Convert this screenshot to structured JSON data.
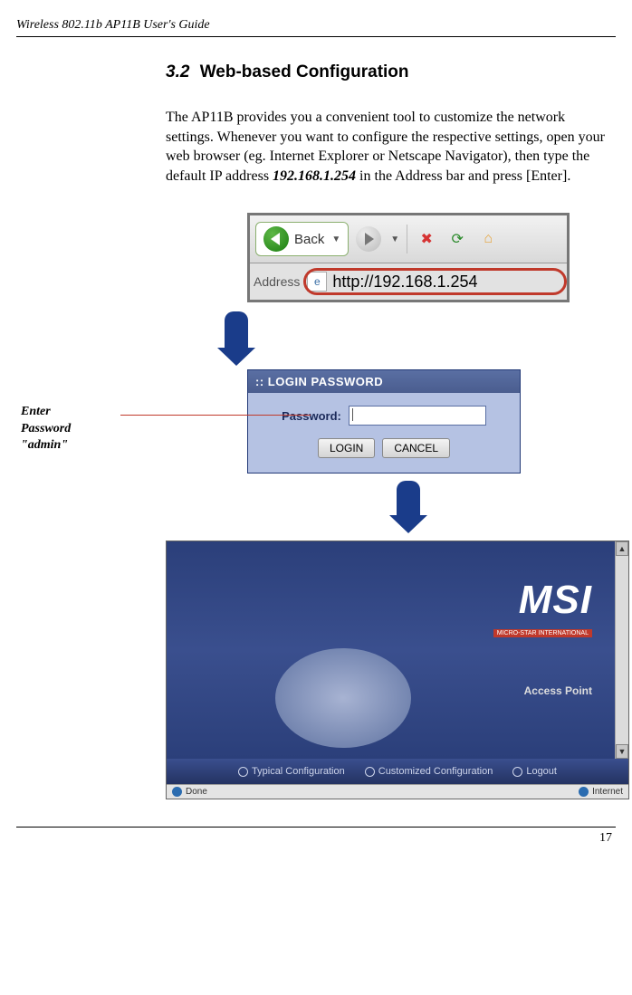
{
  "header": "Wireless 802.11b AP11B User's Guide",
  "section": {
    "number": "3.2",
    "title": "Web-based Configuration"
  },
  "paragraph": {
    "p1": "The AP11B provides you a convenient tool to customize the network settings.  Whenever you want to configure the respective settings, open your web browser (eg. Internet Explorer or Netscape Navigator), then type the default IP address ",
    "ip": "192.168.1.254",
    "p2": " in the Address bar and press [Enter]."
  },
  "browser_toolbar": {
    "back_label": "Back",
    "address_label": "Address",
    "url": "http://192.168.1.254"
  },
  "annotation": {
    "line1": "Enter",
    "line2": "Password",
    "line3": "\"admin\""
  },
  "login_dialog": {
    "title": "LOGIN PASSWORD",
    "password_label": "Password:",
    "login_btn": "LOGIN",
    "cancel_btn": "CANCEL"
  },
  "splash": {
    "logo_big": "MSI",
    "logo_sub": "MICRO-STAR INTERNATIONAL",
    "product": "Access Point",
    "nav": [
      "Typical Configuration",
      "Customized Configuration",
      "Logout"
    ],
    "status_left": "Done",
    "status_right": "Internet"
  },
  "page_number": "17"
}
